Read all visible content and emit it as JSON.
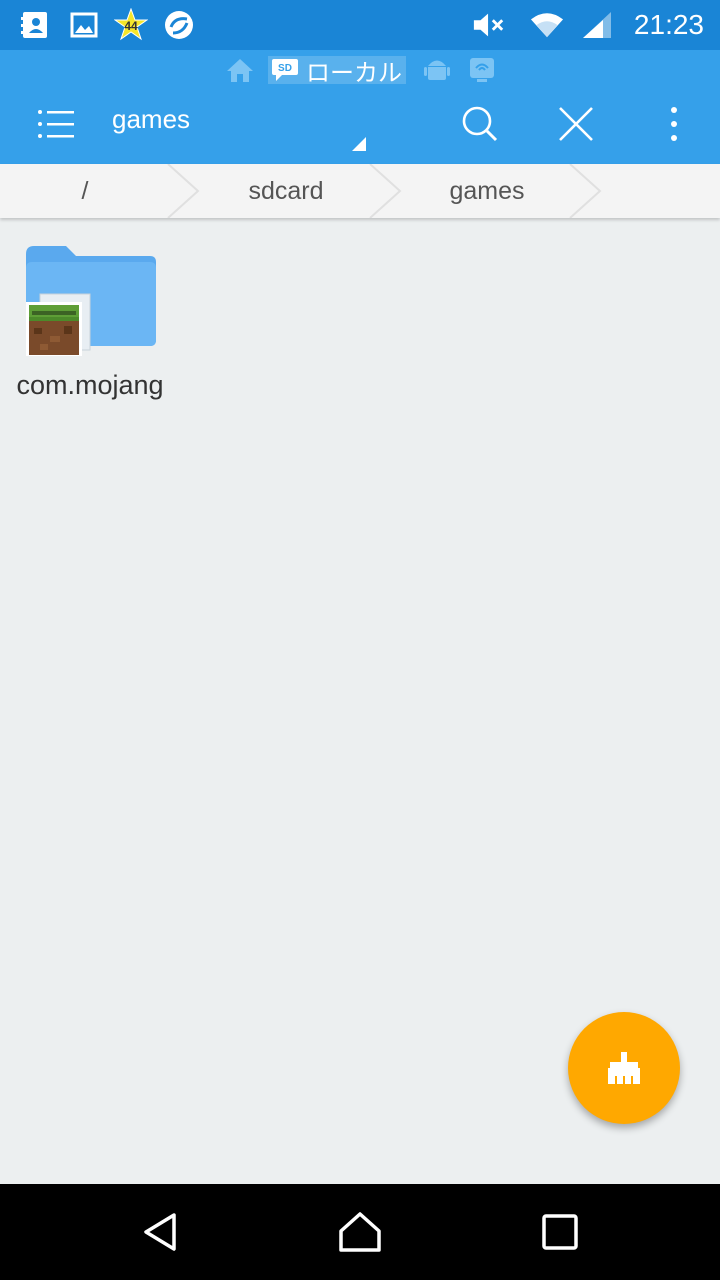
{
  "status_bar": {
    "time": "21:23",
    "notification_badge": "44",
    "icons": [
      "contacts-icon",
      "gallery-icon",
      "star-badge-icon",
      "sync-app-icon",
      "mute-icon",
      "wifi-icon",
      "signal-icon"
    ]
  },
  "source_tabs": {
    "local_label": "ローカル",
    "sd_badge": "SD",
    "icons": [
      "home-icon",
      "sdcard-icon",
      "android-icon",
      "network-icon"
    ]
  },
  "toolbar": {
    "title": "games",
    "icons": [
      "menu-icon",
      "search-icon",
      "close-icon",
      "more-vert-icon"
    ]
  },
  "breadcrumb": {
    "items": [
      "/",
      "sdcard",
      "games"
    ]
  },
  "files": [
    {
      "name": "com.mojang",
      "type": "folder",
      "thumbnail": "minecraft-icon"
    }
  ],
  "fab": {
    "icon": "broom-clean-icon"
  },
  "nav_bar": {
    "icons": [
      "back-icon",
      "home-nav-icon",
      "recents-icon"
    ]
  },
  "colors": {
    "status_bar": "#1A85D6",
    "app_bar": "#35A0EA",
    "breadcrumb_bg": "#F4F4F4",
    "content_bg": "#ECEFF0",
    "folder": "#64B5F6",
    "fab": "#FFA800"
  }
}
